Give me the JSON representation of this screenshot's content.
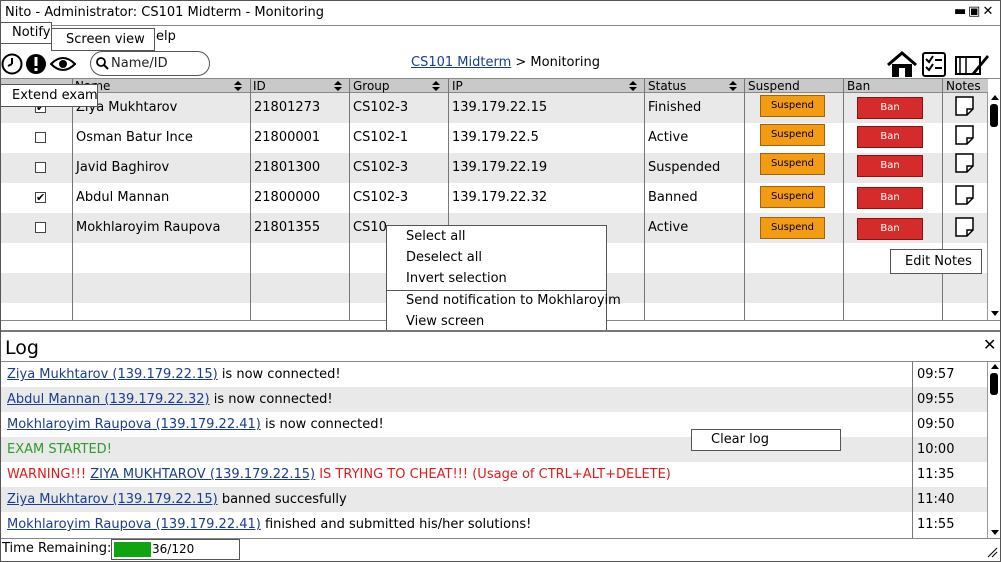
{
  "window": {
    "title": "Nito - Administrator: CS101 Midterm - Monitoring",
    "minimize": "▬",
    "restore": "▣",
    "close": "✕"
  },
  "menu": {
    "help_partial": "elp"
  },
  "tooltips": {
    "notify": "Notify",
    "screen_view": "Screen view",
    "extend_exam": "Extend exam",
    "edit_notes": "Edit Notes"
  },
  "toolbar": {
    "search_placeholder": "Name/ID",
    "breadcrumb_root": "CS101 Midterm",
    "breadcrumb_sep": ">",
    "breadcrumb_current": "Monitoring",
    "icons": [
      "clock-icon",
      "alert-icon",
      "eye-icon",
      "home-icon",
      "checklist-icon",
      "edit-icon"
    ]
  },
  "table": {
    "columns": [
      "Name",
      "ID",
      "Group",
      "IP",
      "Status",
      "Suspend",
      "Ban",
      "Notes"
    ],
    "suspend_label": "Suspend",
    "ban_label": "Ban",
    "rows": [
      {
        "checked": true,
        "name": "Ziya Mukhtarov",
        "id": "21801273",
        "group": "CS102-3",
        "ip": "139.179.22.15",
        "status": "Finished"
      },
      {
        "checked": false,
        "name": "Osman Batur Ince",
        "id": "21800001",
        "group": "CS102-1",
        "ip": "139.179.22.5",
        "status": "Active"
      },
      {
        "checked": false,
        "name": "Javid Baghirov",
        "id": "21801300",
        "group": "CS102-3",
        "ip": "139.179.22.19",
        "status": "Suspended"
      },
      {
        "checked": true,
        "name": "Abdul Mannan",
        "id": "21800000",
        "group": "CS102-3",
        "ip": "139.179.22.32",
        "status": "Banned"
      },
      {
        "checked": false,
        "name": "Mokhlaroyim Raupova",
        "id": "21801355",
        "group": "CS10",
        "ip": "",
        "status": "Active"
      }
    ]
  },
  "context_menu": {
    "select_all": "Select all",
    "deselect_all": "Deselect all",
    "invert_selection": "Invert selection",
    "send_notification": "Send notification to Mokhlaroyim",
    "view_screen": "View screen"
  },
  "log": {
    "title": "Log",
    "close": "✕",
    "clear_label": "Clear log",
    "entries": [
      {
        "link": "Ziya Mukhtarov (139.179.22.15)",
        "text": " is now connected!",
        "time": "09:57"
      },
      {
        "link": "Abdul Mannan (139.179.22.32)",
        "text": " is now connected!",
        "time": "09:55"
      },
      {
        "link": "Mokhlaroyim Raupova (139.179.22.41)",
        "text": " is now connected!",
        "time": "09:50"
      },
      {
        "text": "EXAM STARTED!",
        "time": "10:00",
        "color": "#2d9b2d"
      },
      {
        "prefix": "WARNING!!! ",
        "link": "ZIYA MUKHTAROV (139.179.22.15)",
        "text": " IS TRYING TO CHEAT!!! (Usage of CTRL+ALT+DELETE)",
        "time": "11:35",
        "color": "#e01b1b"
      },
      {
        "link": "Ziya Mukhtarov (139.179.22.15)",
        "text": " banned succesfully",
        "time": "11:40"
      },
      {
        "link": "Mokhlaroyim Raupova (139.179.22.41)",
        "text": " finished and submitted his/her solutions!",
        "time": "11:55"
      }
    ]
  },
  "status": {
    "time_remaining_label": "Time Remaining:",
    "progress_text": "36/120",
    "progress_value": 36,
    "progress_max": 120
  },
  "colors": {
    "suspend": "#f39c12",
    "ban": "#d52b2b",
    "progress": "#10a510",
    "link": "#1a3d8f"
  }
}
